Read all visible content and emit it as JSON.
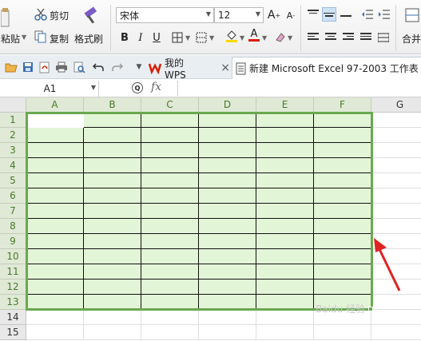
{
  "ribbon": {
    "paste_label": "粘贴",
    "cut_label": "剪切",
    "copy_label": "复制",
    "format_painter_label": "格式刷",
    "font_name": "宋体",
    "font_size": "12",
    "bold": "B",
    "italic": "I",
    "underline": "U",
    "merge_label": "合并",
    "grow_font": "A",
    "shrink_font": "A",
    "font_color_letter": "A",
    "font_color": "#d81e06",
    "fill_color": "#ffd800"
  },
  "quickbar": {
    "wps_tab_label": "我的WPS",
    "wps_close": "×",
    "file_tab_label": "新建 Microsoft Excel 97-2003 工作表 ("
  },
  "formula_bar": {
    "name_box": "A1",
    "zoom_icon": "Q",
    "fx_label": "fx"
  },
  "sheet": {
    "columns": [
      "A",
      "B",
      "C",
      "D",
      "E",
      "F",
      "G"
    ],
    "rows": [
      "1",
      "2",
      "3",
      "4",
      "5",
      "6",
      "7",
      "8",
      "9",
      "10",
      "11",
      "12",
      "13",
      "14",
      "15"
    ],
    "selection_color": "#6aa84f",
    "selection_fill": "#e3f5d7",
    "annotation_color": "#e02222"
  },
  "watermark": "Baidu 经验"
}
